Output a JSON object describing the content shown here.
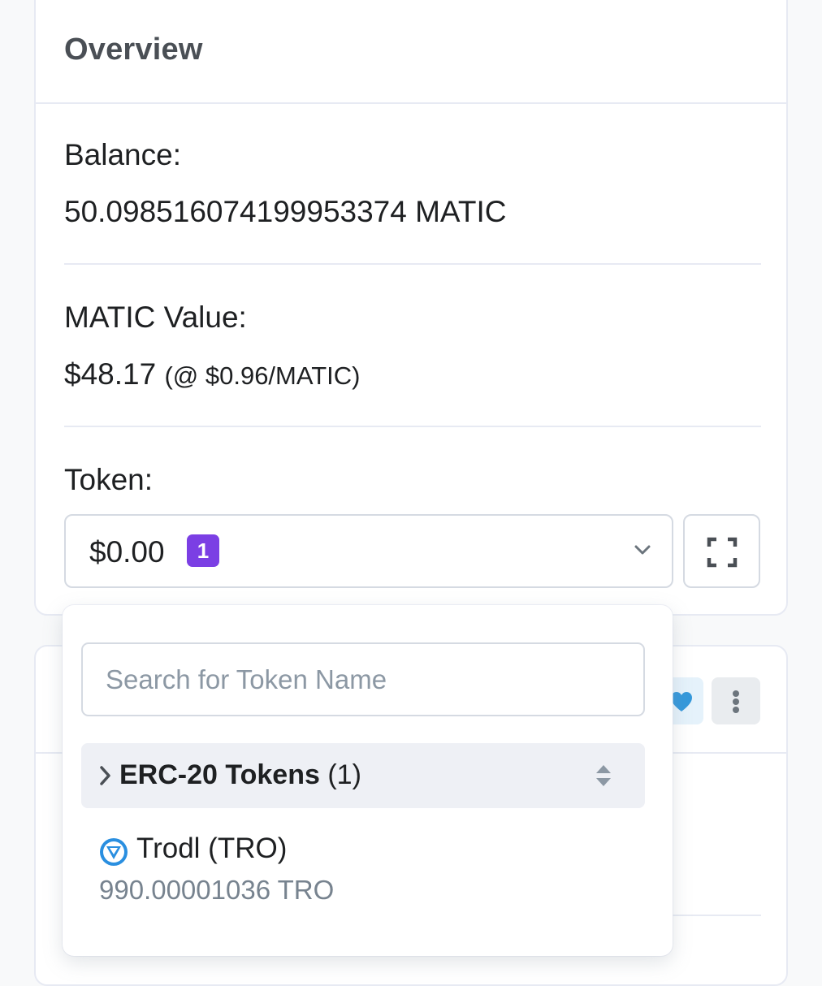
{
  "overview": {
    "title": "Overview",
    "balance_label": "Balance:",
    "balance_value": "50.098516074199953374 MATIC",
    "matic_value_label": "MATIC Value:",
    "matic_value_usd": "$48.17",
    "matic_value_rate": "(@ $0.96/MATIC)",
    "token_label": "Token:"
  },
  "token_select": {
    "value": "$0.00",
    "badge_count": "1",
    "badge_color": "#7b3fe4",
    "chevron_icon": "chevron-down-icon",
    "expand_icon": "expand-icon"
  },
  "dropdown": {
    "search_placeholder": "Search for Token Name",
    "group": {
      "title": "ERC-20 Tokens",
      "count": "(1)"
    },
    "tokens": [
      {
        "name": "Trodl (TRO)",
        "quantity": "990.00001036 TRO",
        "icon": "trodl-token-icon",
        "icon_color": "#2a8fe0"
      }
    ]
  },
  "second_card": {
    "favorite_icon": "heart-icon",
    "more_icon": "more-vertical-icon",
    "favorite_color": "#3498db"
  }
}
